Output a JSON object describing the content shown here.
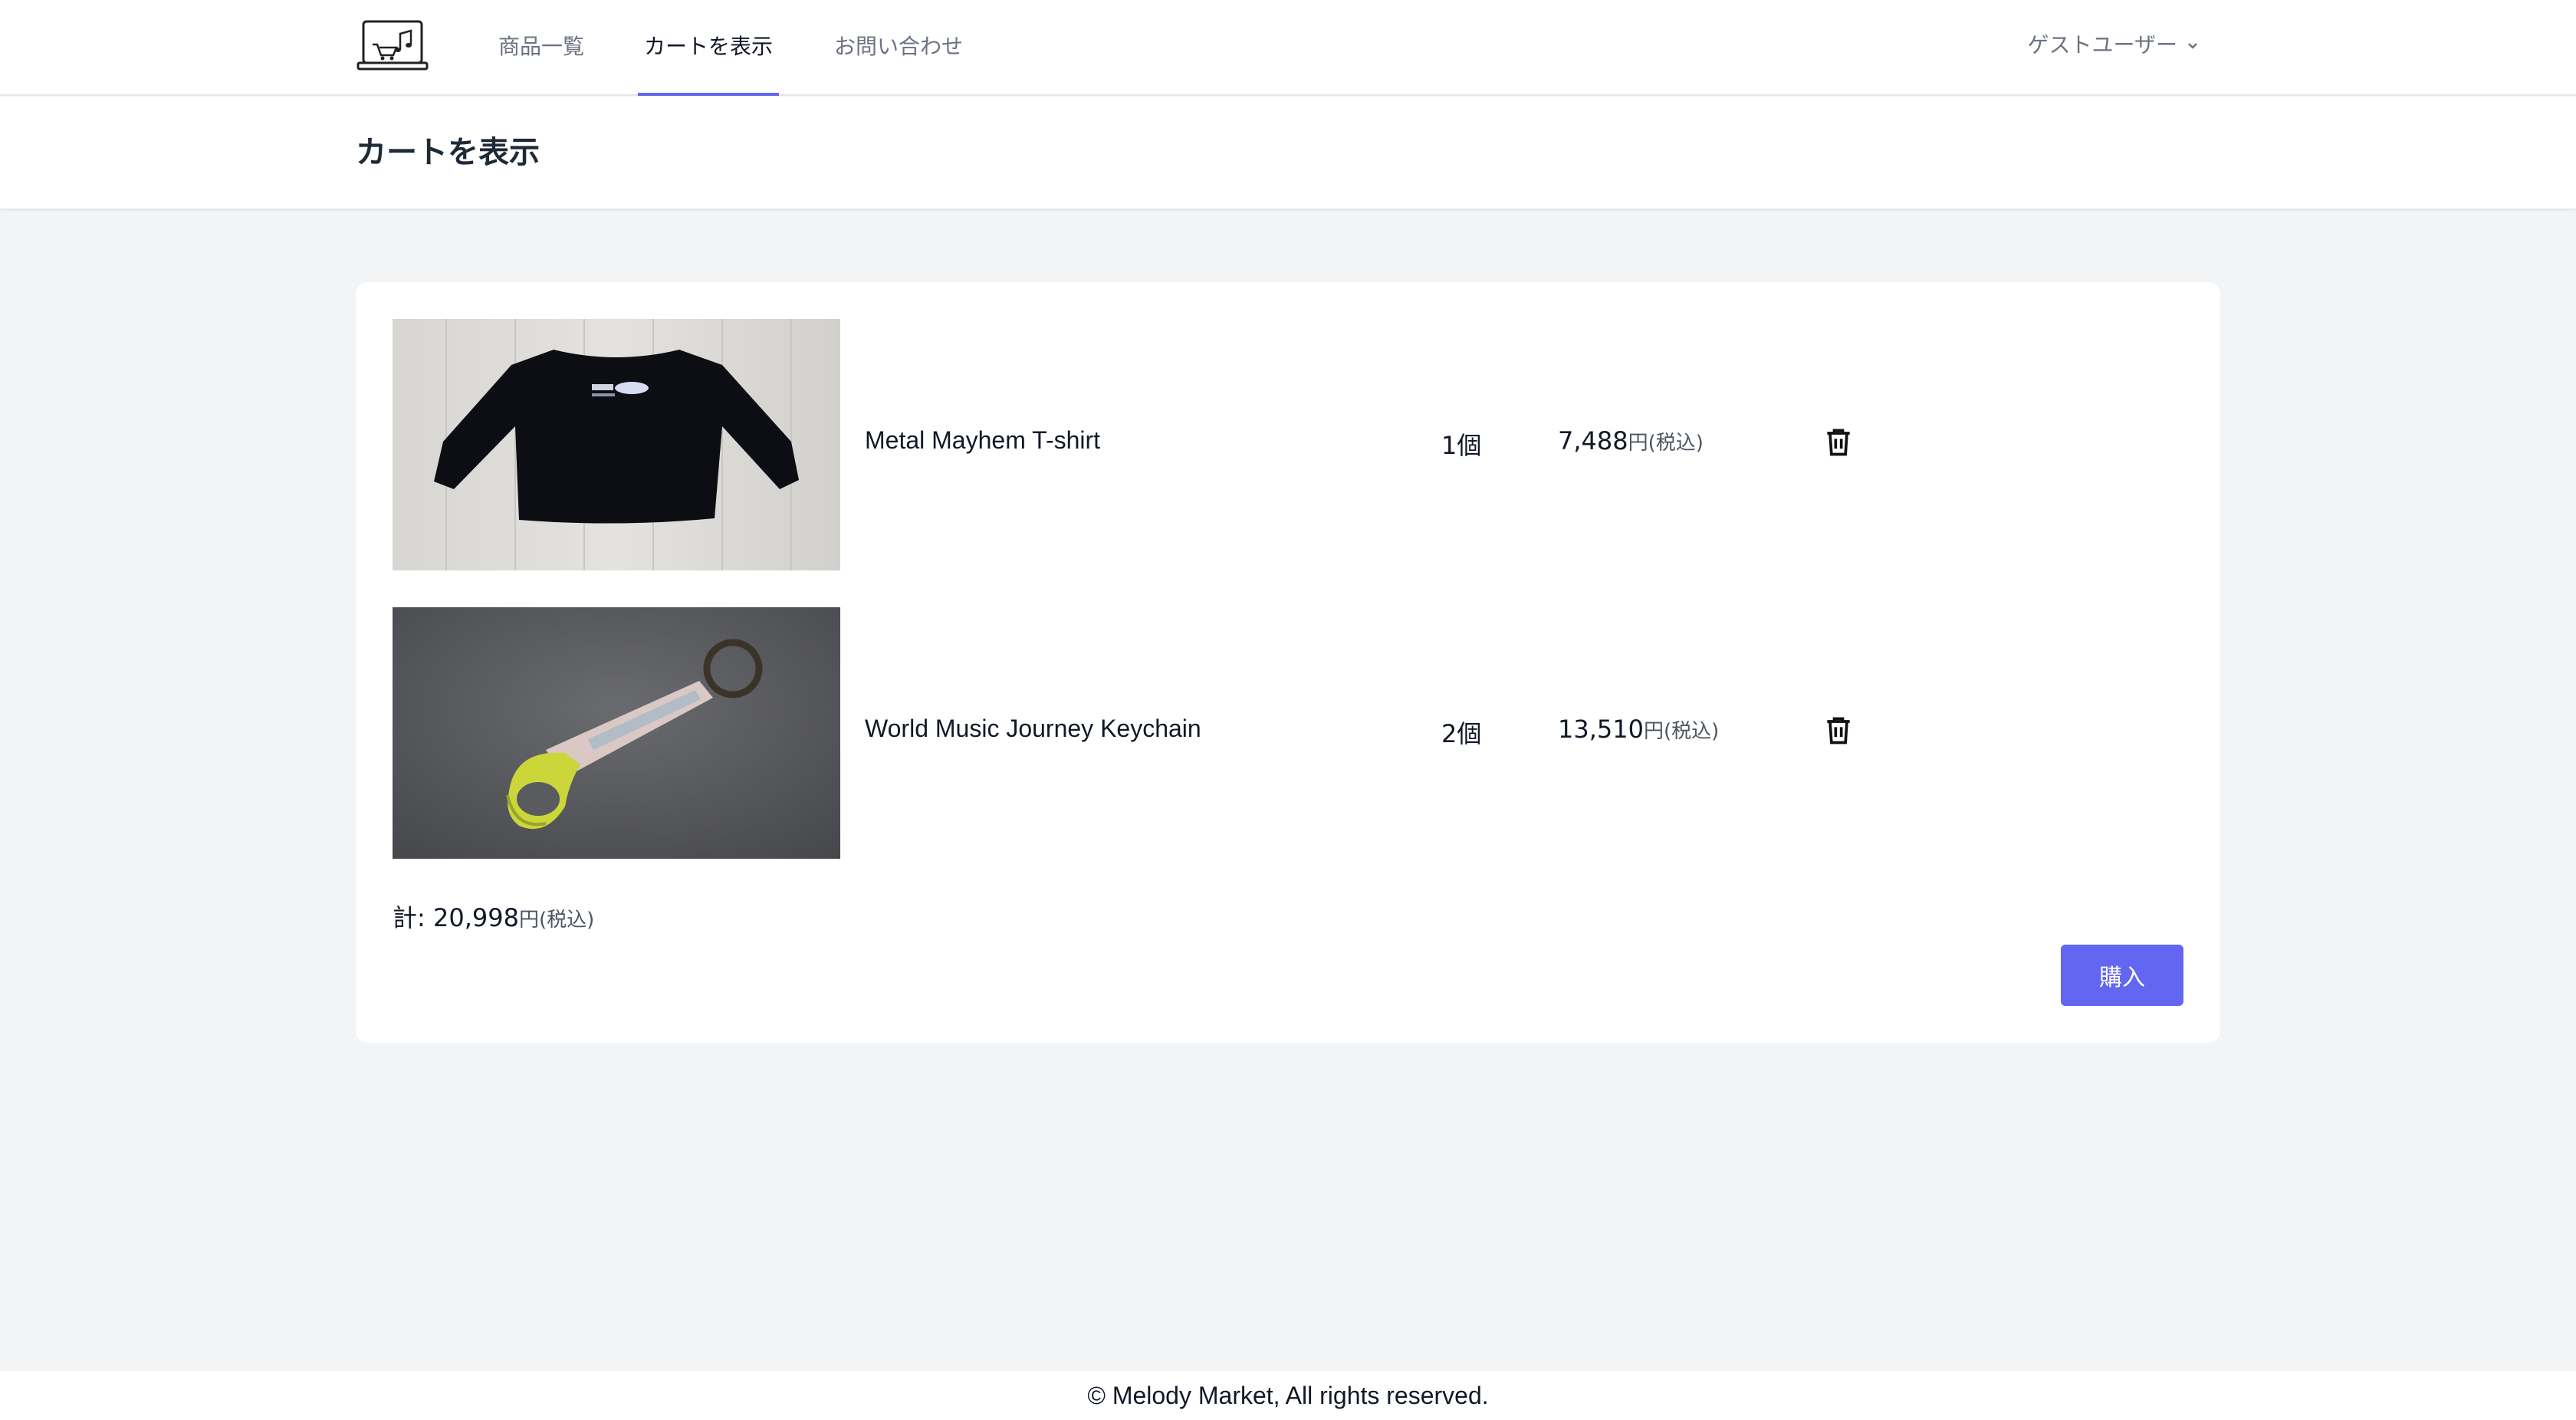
{
  "nav": {
    "links": [
      {
        "label": "商品一覧"
      },
      {
        "label": "カートを表示"
      },
      {
        "label": "お問い合わせ"
      }
    ],
    "active_index": 1,
    "user_label": "ゲストユーザー",
    "logo_icon": "laptop-cart-music-logo",
    "accent_color": "#6366f1"
  },
  "page": {
    "title": "カートを表示"
  },
  "cart": {
    "items": [
      {
        "name": "Metal Mayhem T-shirt",
        "quantity": "1個",
        "price": "7,488",
        "price_suffix": "円(税込)",
        "image": "black long-sleeve t-shirt on wooden floor",
        "delete_icon": "trash-icon"
      },
      {
        "name": "World Music Journey Keychain",
        "quantity": "2個",
        "price": "13,510",
        "price_suffix": "円(税込)",
        "image": "yellow carabiner keychain on gray surface",
        "delete_icon": "trash-icon"
      }
    ],
    "total_label": "計: ",
    "total_value": "20,998",
    "total_suffix": "円(税込)",
    "buy_label": "購入"
  },
  "footer": {
    "text": "© Melody Market, All rights reserved."
  }
}
